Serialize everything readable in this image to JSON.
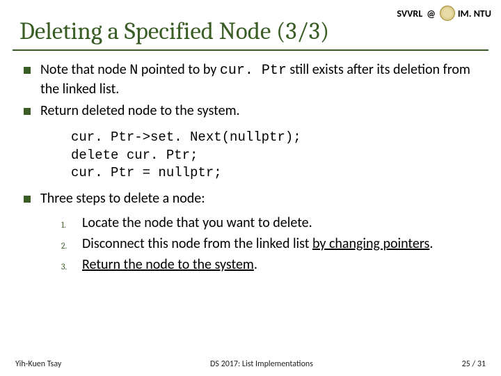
{
  "header": {
    "left": "SVVRL",
    "at": "@",
    "right": "IM. NTU"
  },
  "title": "Deleting a Specified Node (3/3)",
  "bullets1": {
    "b1_pre": "Note that node ",
    "b1_code1": "N",
    "b1_mid": " pointed to by ",
    "b1_code2": "cur. Ptr",
    "b1_post": " still exists after its deletion from the linked list.",
    "b2": "Return deleted node to the system."
  },
  "code": {
    "l1": "cur. Ptr->set. Next(nullptr);",
    "l2": "delete cur. Ptr;",
    "l3": "cur. Ptr = nullptr;"
  },
  "bullet3": "Three steps to delete a node:",
  "steps": {
    "n1": "1.",
    "t1": "Locate the node that you want to delete.",
    "n2": "2.",
    "t2_pre": "Disconnect this node from the linked list ",
    "t2_ul": "by changing pointers",
    "t2_post": ".",
    "n3": "3.",
    "t3_pre": "",
    "t3_ul": "Return the node to the system",
    "t3_post": "."
  },
  "footer": {
    "left": "Yih-Kuen Tsay",
    "center": "DS 2017: List Implementations",
    "right": "25 / 31"
  }
}
